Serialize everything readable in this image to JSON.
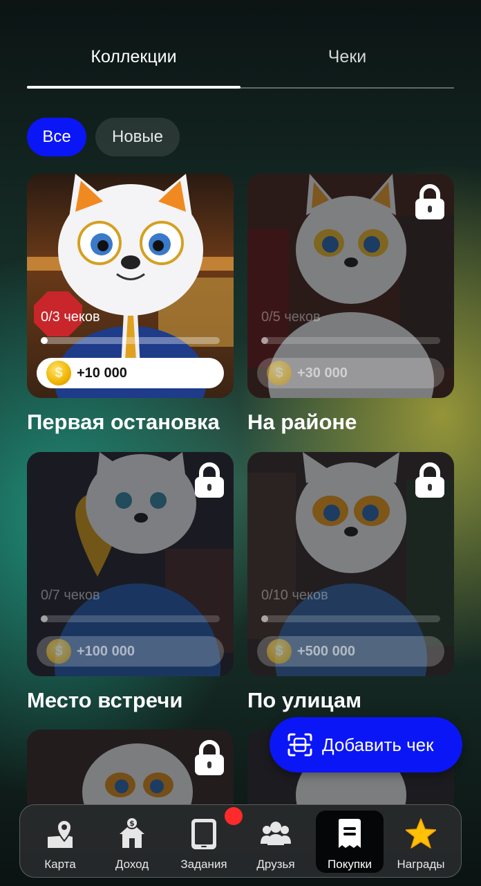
{
  "tabs": [
    {
      "label": "Коллекции",
      "active": true
    },
    {
      "label": "Чеки",
      "active": false
    }
  ],
  "filters": [
    {
      "label": "Все",
      "active": true
    },
    {
      "label": "Новые",
      "active": false
    }
  ],
  "collections": [
    {
      "title": "Первая остановка",
      "progress_text": "0/3 чеков",
      "progress": 0.04,
      "reward": "+10 000",
      "locked": false
    },
    {
      "title": "На районе",
      "progress_text": "0/5 чеков",
      "progress": 0.04,
      "reward": "+30 000",
      "locked": true
    },
    {
      "title": "Место встречи",
      "progress_text": "0/7 чеков",
      "progress": 0.04,
      "reward": "+100 000",
      "locked": true
    },
    {
      "title": "По улицам",
      "progress_text": "0/10 чеков",
      "progress": 0.04,
      "reward": "+500 000",
      "locked": true
    }
  ],
  "fab": {
    "label": "Добавить чек",
    "icon": "scan-receipt-icon"
  },
  "bottom_nav": [
    {
      "label": "Карта",
      "icon": "map-icon",
      "active": false
    },
    {
      "label": "Доход",
      "icon": "income-house-icon",
      "active": false
    },
    {
      "label": "Задания",
      "icon": "tablet-icon",
      "active": false,
      "badge": true
    },
    {
      "label": "Друзья",
      "icon": "friends-icon",
      "active": false
    },
    {
      "label": "Покупки",
      "icon": "receipt-icon",
      "active": true
    },
    {
      "label": "Награды",
      "icon": "star-icon",
      "active": false
    }
  ],
  "colors": {
    "accent": "#0a16f5",
    "badge": "#ff2a2a",
    "coin": "#f0b400",
    "star": "#ffc107"
  }
}
